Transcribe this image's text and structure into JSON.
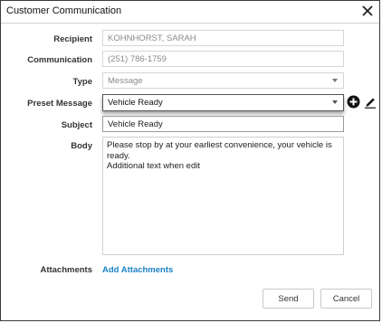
{
  "dialog": {
    "title": "Customer Communication"
  },
  "form": {
    "recipient": {
      "label": "Recipient",
      "value": "KOHNHORST, SARAH"
    },
    "communication": {
      "label": "Communication",
      "value": "(251) 786-1759"
    },
    "type": {
      "label": "Type",
      "value": "Message"
    },
    "preset_message": {
      "label": "Preset Message",
      "value": "Vehicle Ready"
    },
    "subject": {
      "label": "Subject",
      "value": "Vehicle Ready"
    },
    "body": {
      "label": "Body",
      "line1": "Please stop by at your earliest convenience, your vehicle is",
      "line2": "ready.",
      "line3": "Additional text when edit"
    },
    "attachments": {
      "label": "Attachments",
      "link": "Add Attachments"
    }
  },
  "buttons": {
    "send": "Send",
    "cancel": "Cancel"
  },
  "icons": {
    "add": "plus-circle-icon",
    "edit": "pencil-icon",
    "close": "close-icon"
  }
}
